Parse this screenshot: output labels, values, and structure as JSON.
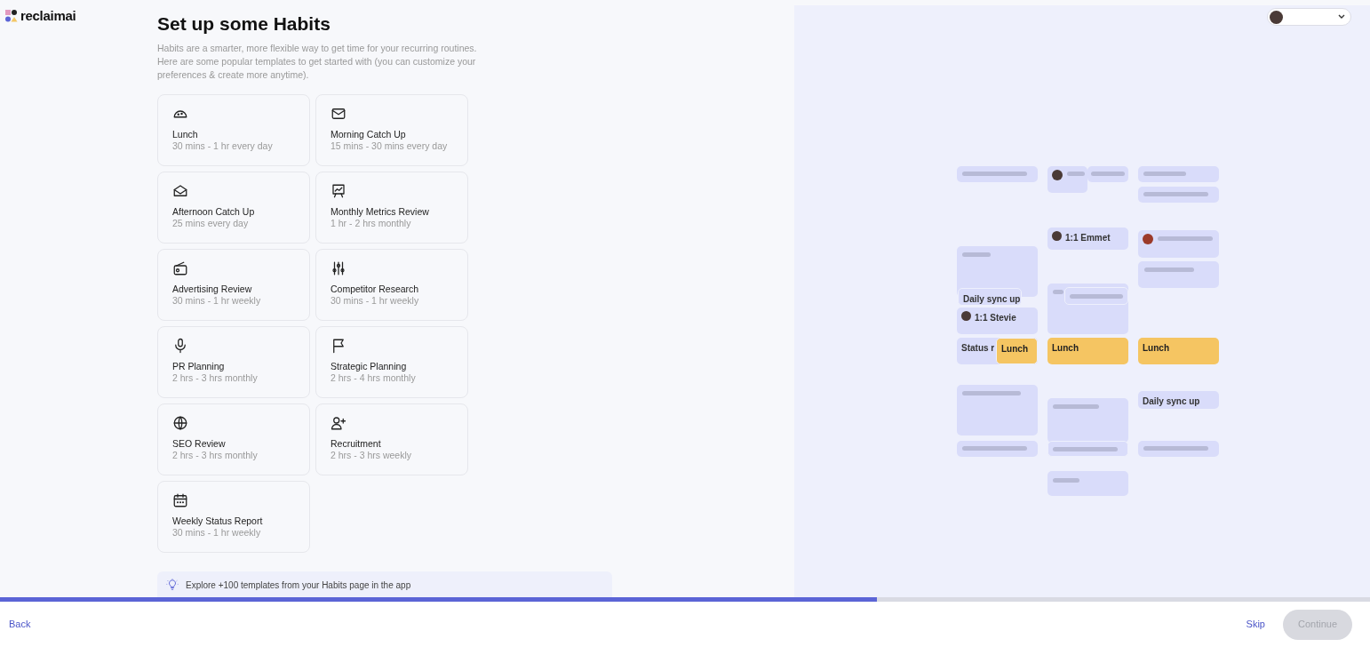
{
  "logo": {
    "text": "reclaimai"
  },
  "heading": "Set up some Habits",
  "intro": "Habits are a smarter, more flexible way to get time for your recurring routines. Here are some popular templates to get started with (you can customize your preferences & create more anytime).",
  "templates": [
    {
      "title": "Lunch",
      "duration": "30 mins - 1 hr every day"
    },
    {
      "title": "Morning Catch Up",
      "duration": "15 mins - 30 mins every day"
    },
    {
      "title": "Afternoon Catch Up",
      "duration": "25 mins every day"
    },
    {
      "title": "Monthly Metrics Review",
      "duration": "1 hr - 2 hrs monthly"
    },
    {
      "title": "Advertising Review",
      "duration": "30 mins - 1 hr weekly"
    },
    {
      "title": "Competitor Research",
      "duration": "30 mins - 1 hr weekly"
    },
    {
      "title": "PR Planning",
      "duration": "2 hrs - 3 hrs monthly"
    },
    {
      "title": "Strategic Planning",
      "duration": "2 hrs - 4 hrs monthly"
    },
    {
      "title": "SEO Review",
      "duration": "2 hrs - 3 hrs monthly"
    },
    {
      "title": "Recruitment",
      "duration": "2 hrs - 3 hrs weekly"
    },
    {
      "title": "Weekly Status Report",
      "duration": "30 mins - 1 hr weekly"
    }
  ],
  "tip": "Explore +100 templates from your Habits page in the app",
  "preview": {
    "events": [
      {
        "label": "Daily sync up",
        "kind": "meeting",
        "avatar": false
      },
      {
        "label": "1:1 Stevie",
        "kind": "meeting",
        "avatar": true
      },
      {
        "label": "Status r",
        "kind": "meeting",
        "avatar": false
      },
      {
        "label": "Lunch",
        "kind": "lunch",
        "avatar": false
      },
      {
        "label": "1:1 Emmet",
        "kind": "meeting",
        "avatar": true
      },
      {
        "label": "Lunch",
        "kind": "lunch",
        "avatar": false
      },
      {
        "label": "Lunch",
        "kind": "lunch",
        "avatar": false
      },
      {
        "label": "Daily sync up",
        "kind": "meeting",
        "avatar": false
      }
    ]
  },
  "progress": {
    "level": 0.64
  },
  "footer": {
    "back": "Back",
    "skip": "Skip",
    "continue": {
      "label": "Continue",
      "disabled": true
    }
  }
}
